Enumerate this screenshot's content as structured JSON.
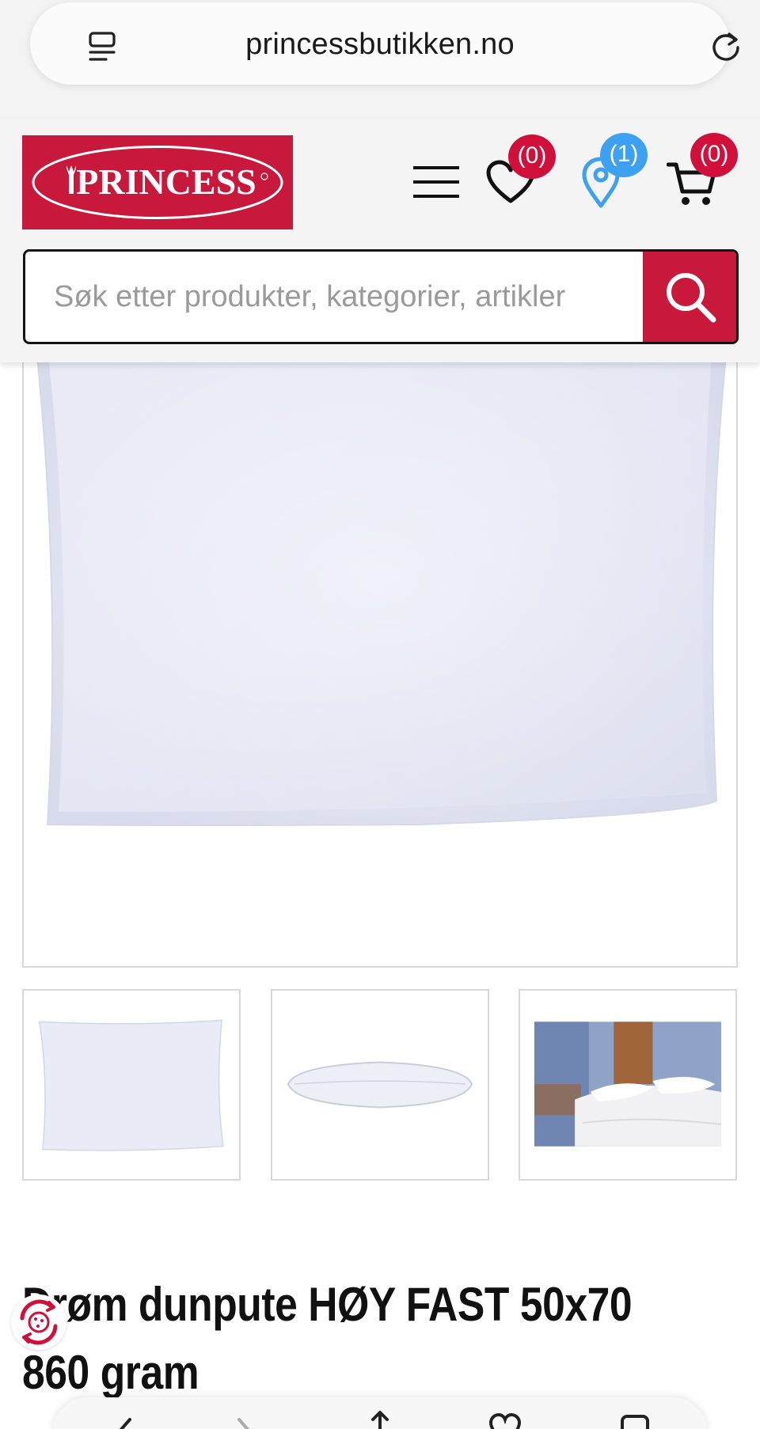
{
  "browser": {
    "url": "princessbutikken.no"
  },
  "header": {
    "logo_text": "PRINCESS",
    "wishlist_count": "(0)",
    "store_count": "(1)",
    "cart_count": "(0)"
  },
  "search": {
    "placeholder": "Søk etter produkter, kategorier, artikler"
  },
  "product": {
    "title": "Drøm dunpute HØY FAST 50x70 860 gram"
  },
  "colors": {
    "brand_red": "#c8193c",
    "badge_red": "#d0103a",
    "badge_blue": "#3ea0f0"
  },
  "icons": [
    "tabs-icon",
    "reload-icon",
    "menu-icon",
    "heart-icon",
    "location-pin-icon",
    "cart-icon",
    "search-icon",
    "cookie-settings-icon",
    "back-icon",
    "forward-icon",
    "share-icon",
    "bookmarks-icon",
    "tabs-overview-icon"
  ]
}
